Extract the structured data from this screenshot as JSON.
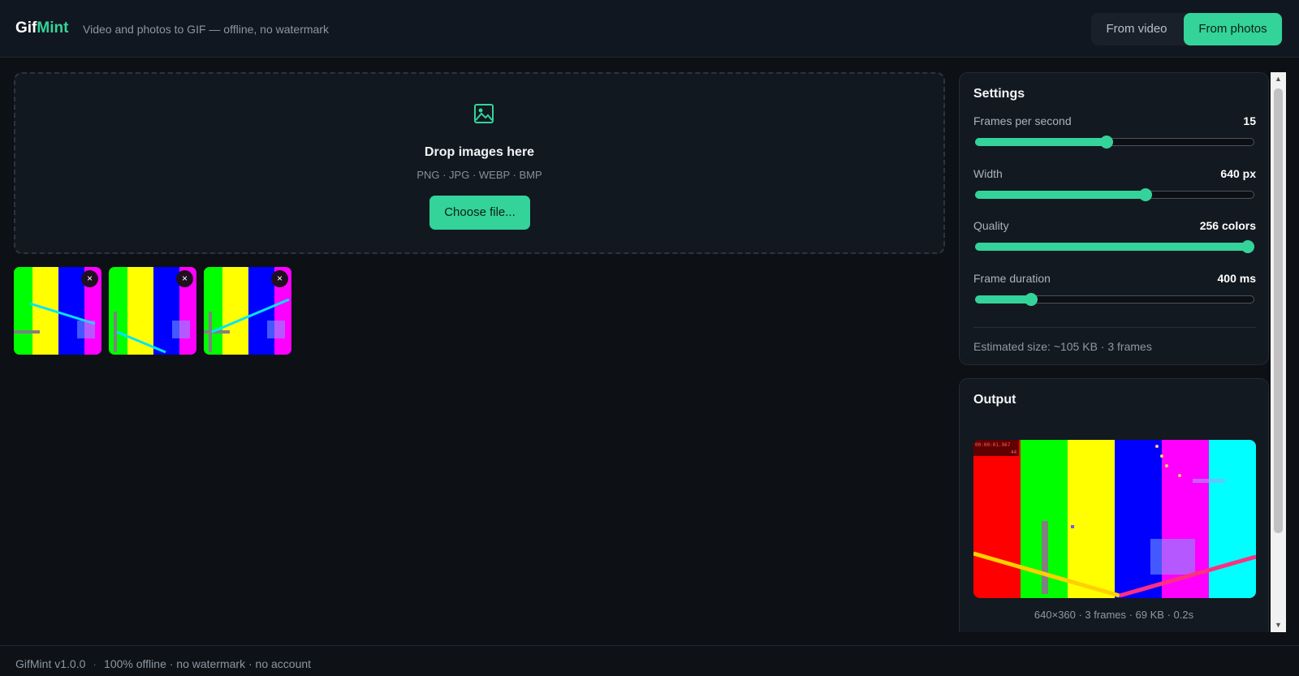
{
  "app": {
    "logo_part1": "Gif",
    "logo_part2": "Mint",
    "tagline": "Video and photos to GIF — offline, no watermark",
    "accent_color": "#34d399"
  },
  "mode_toggle": {
    "options": [
      "From video",
      "From photos"
    ],
    "selected": "From photos"
  },
  "dropzone": {
    "icon": "image-icon",
    "title": "Drop images here",
    "formats": "PNG · JPG · WEBP · BMP",
    "button_label": "Choose file..."
  },
  "thumbnails": [
    {
      "remove_label": "×"
    },
    {
      "remove_label": "×"
    },
    {
      "remove_label": "×"
    }
  ],
  "settings": {
    "title": "Settings",
    "fps": {
      "label": "Frames per second",
      "value": "15",
      "level": 0.47
    },
    "width": {
      "label": "Width",
      "value": "640 px",
      "level": 0.61
    },
    "quality": {
      "label": "Quality",
      "value": "256 colors",
      "level": 1.0
    },
    "duration": {
      "label": "Frame duration",
      "value": "400 ms",
      "level": 0.2
    },
    "estimate": "Estimated size: ~105 KB · 3 frames"
  },
  "output": {
    "title": "Output",
    "timecode": "00:00:01.967",
    "frame_num": "44",
    "caption": "640×360 · 3 frames · 69 KB · 0.2s"
  },
  "footer": {
    "version": "GifMint v1.0.0",
    "separator": "·",
    "note": "100% offline · no watermark · no account"
  }
}
